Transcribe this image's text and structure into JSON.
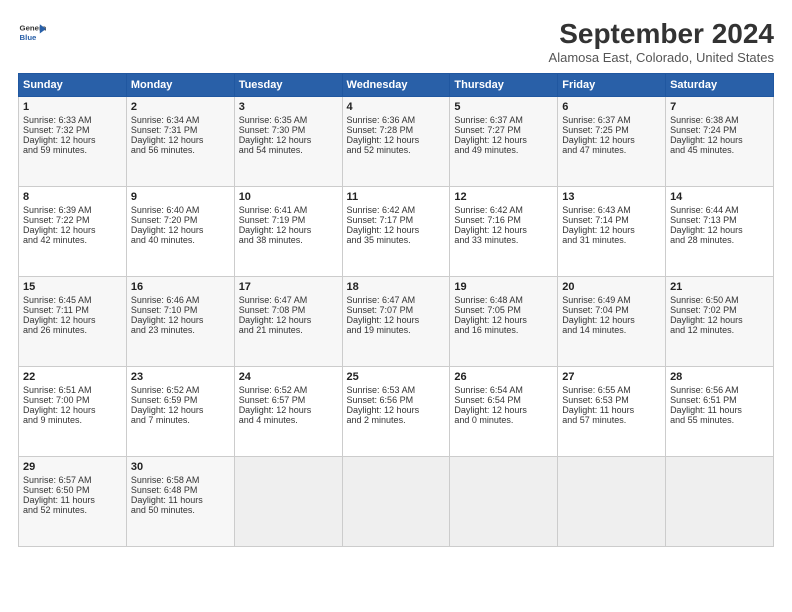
{
  "header": {
    "logo_line1": "General",
    "logo_line2": "Blue",
    "month_title": "September 2024",
    "subtitle": "Alamosa East, Colorado, United States"
  },
  "weekdays": [
    "Sunday",
    "Monday",
    "Tuesday",
    "Wednesday",
    "Thursday",
    "Friday",
    "Saturday"
  ],
  "weeks": [
    [
      {
        "day": "1",
        "lines": [
          "Sunrise: 6:33 AM",
          "Sunset: 7:32 PM",
          "Daylight: 12 hours",
          "and 59 minutes."
        ]
      },
      {
        "day": "2",
        "lines": [
          "Sunrise: 6:34 AM",
          "Sunset: 7:31 PM",
          "Daylight: 12 hours",
          "and 56 minutes."
        ]
      },
      {
        "day": "3",
        "lines": [
          "Sunrise: 6:35 AM",
          "Sunset: 7:30 PM",
          "Daylight: 12 hours",
          "and 54 minutes."
        ]
      },
      {
        "day": "4",
        "lines": [
          "Sunrise: 6:36 AM",
          "Sunset: 7:28 PM",
          "Daylight: 12 hours",
          "and 52 minutes."
        ]
      },
      {
        "day": "5",
        "lines": [
          "Sunrise: 6:37 AM",
          "Sunset: 7:27 PM",
          "Daylight: 12 hours",
          "and 49 minutes."
        ]
      },
      {
        "day": "6",
        "lines": [
          "Sunrise: 6:37 AM",
          "Sunset: 7:25 PM",
          "Daylight: 12 hours",
          "and 47 minutes."
        ]
      },
      {
        "day": "7",
        "lines": [
          "Sunrise: 6:38 AM",
          "Sunset: 7:24 PM",
          "Daylight: 12 hours",
          "and 45 minutes."
        ]
      }
    ],
    [
      {
        "day": "8",
        "lines": [
          "Sunrise: 6:39 AM",
          "Sunset: 7:22 PM",
          "Daylight: 12 hours",
          "and 42 minutes."
        ]
      },
      {
        "day": "9",
        "lines": [
          "Sunrise: 6:40 AM",
          "Sunset: 7:20 PM",
          "Daylight: 12 hours",
          "and 40 minutes."
        ]
      },
      {
        "day": "10",
        "lines": [
          "Sunrise: 6:41 AM",
          "Sunset: 7:19 PM",
          "Daylight: 12 hours",
          "and 38 minutes."
        ]
      },
      {
        "day": "11",
        "lines": [
          "Sunrise: 6:42 AM",
          "Sunset: 7:17 PM",
          "Daylight: 12 hours",
          "and 35 minutes."
        ]
      },
      {
        "day": "12",
        "lines": [
          "Sunrise: 6:42 AM",
          "Sunset: 7:16 PM",
          "Daylight: 12 hours",
          "and 33 minutes."
        ]
      },
      {
        "day": "13",
        "lines": [
          "Sunrise: 6:43 AM",
          "Sunset: 7:14 PM",
          "Daylight: 12 hours",
          "and 31 minutes."
        ]
      },
      {
        "day": "14",
        "lines": [
          "Sunrise: 6:44 AM",
          "Sunset: 7:13 PM",
          "Daylight: 12 hours",
          "and 28 minutes."
        ]
      }
    ],
    [
      {
        "day": "15",
        "lines": [
          "Sunrise: 6:45 AM",
          "Sunset: 7:11 PM",
          "Daylight: 12 hours",
          "and 26 minutes."
        ]
      },
      {
        "day": "16",
        "lines": [
          "Sunrise: 6:46 AM",
          "Sunset: 7:10 PM",
          "Daylight: 12 hours",
          "and 23 minutes."
        ]
      },
      {
        "day": "17",
        "lines": [
          "Sunrise: 6:47 AM",
          "Sunset: 7:08 PM",
          "Daylight: 12 hours",
          "and 21 minutes."
        ]
      },
      {
        "day": "18",
        "lines": [
          "Sunrise: 6:47 AM",
          "Sunset: 7:07 PM",
          "Daylight: 12 hours",
          "and 19 minutes."
        ]
      },
      {
        "day": "19",
        "lines": [
          "Sunrise: 6:48 AM",
          "Sunset: 7:05 PM",
          "Daylight: 12 hours",
          "and 16 minutes."
        ]
      },
      {
        "day": "20",
        "lines": [
          "Sunrise: 6:49 AM",
          "Sunset: 7:04 PM",
          "Daylight: 12 hours",
          "and 14 minutes."
        ]
      },
      {
        "day": "21",
        "lines": [
          "Sunrise: 6:50 AM",
          "Sunset: 7:02 PM",
          "Daylight: 12 hours",
          "and 12 minutes."
        ]
      }
    ],
    [
      {
        "day": "22",
        "lines": [
          "Sunrise: 6:51 AM",
          "Sunset: 7:00 PM",
          "Daylight: 12 hours",
          "and 9 minutes."
        ]
      },
      {
        "day": "23",
        "lines": [
          "Sunrise: 6:52 AM",
          "Sunset: 6:59 PM",
          "Daylight: 12 hours",
          "and 7 minutes."
        ]
      },
      {
        "day": "24",
        "lines": [
          "Sunrise: 6:52 AM",
          "Sunset: 6:57 PM",
          "Daylight: 12 hours",
          "and 4 minutes."
        ]
      },
      {
        "day": "25",
        "lines": [
          "Sunrise: 6:53 AM",
          "Sunset: 6:56 PM",
          "Daylight: 12 hours",
          "and 2 minutes."
        ]
      },
      {
        "day": "26",
        "lines": [
          "Sunrise: 6:54 AM",
          "Sunset: 6:54 PM",
          "Daylight: 12 hours",
          "and 0 minutes."
        ]
      },
      {
        "day": "27",
        "lines": [
          "Sunrise: 6:55 AM",
          "Sunset: 6:53 PM",
          "Daylight: 11 hours",
          "and 57 minutes."
        ]
      },
      {
        "day": "28",
        "lines": [
          "Sunrise: 6:56 AM",
          "Sunset: 6:51 PM",
          "Daylight: 11 hours",
          "and 55 minutes."
        ]
      }
    ],
    [
      {
        "day": "29",
        "lines": [
          "Sunrise: 6:57 AM",
          "Sunset: 6:50 PM",
          "Daylight: 11 hours",
          "and 52 minutes."
        ]
      },
      {
        "day": "30",
        "lines": [
          "Sunrise: 6:58 AM",
          "Sunset: 6:48 PM",
          "Daylight: 11 hours",
          "and 50 minutes."
        ]
      },
      null,
      null,
      null,
      null,
      null
    ]
  ]
}
